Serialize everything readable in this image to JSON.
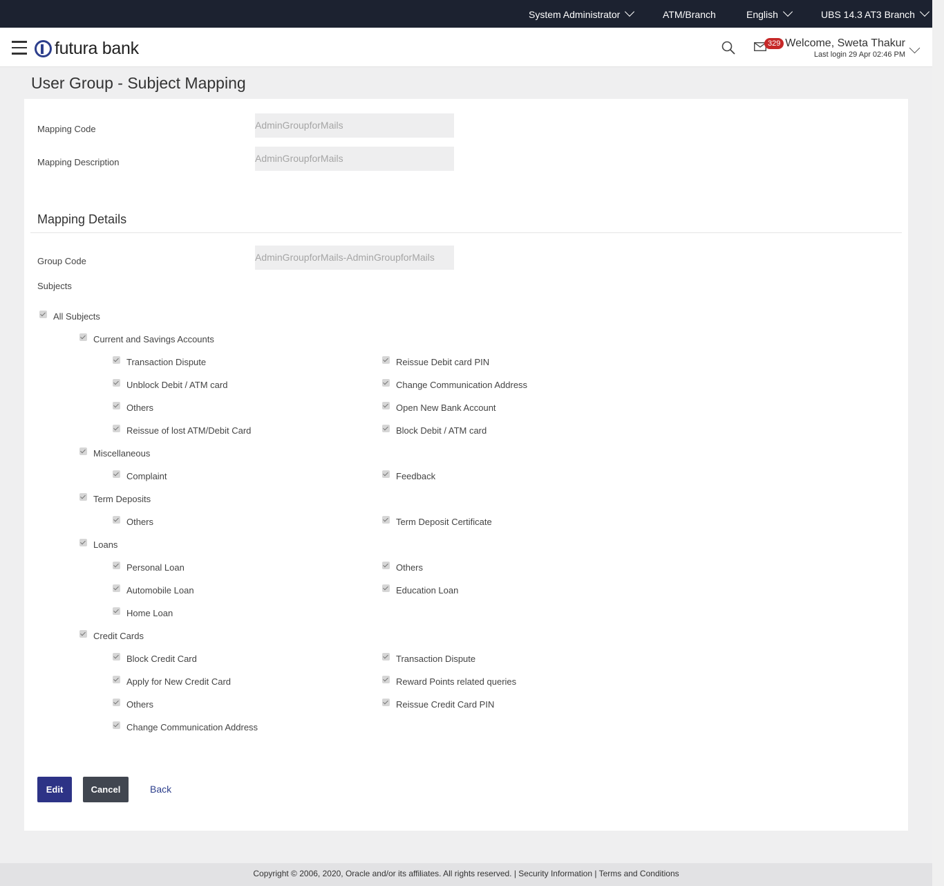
{
  "topbar": {
    "role": "System Administrator",
    "atm_branch": "ATM/Branch",
    "language": "English",
    "branch": "UBS 14.3 AT3 Branch"
  },
  "header": {
    "logo_text": "futura bank",
    "mail_count": "329",
    "welcome": "Welcome, Sweta Thakur",
    "last_login": "Last login 29 Apr 02:46 PM"
  },
  "page": {
    "title": "User Group - Subject Mapping"
  },
  "form": {
    "mapping_code_label": "Mapping Code",
    "mapping_code_value": "AdminGroupforMails",
    "mapping_description_label": "Mapping Description",
    "mapping_description_value": "AdminGroupforMails",
    "section_title": "Mapping Details",
    "group_code_label": "Group Code",
    "group_code_value": "AdminGroupforMails-AdminGroupforMails",
    "subjects_label": "Subjects"
  },
  "subjects": {
    "all": "All Subjects",
    "casa": {
      "label": "Current and Savings Accounts",
      "items": [
        "Transaction Dispute",
        "Reissue Debit card PIN",
        "Unblock Debit / ATM card",
        "Change Communication Address",
        "Others",
        "Open New Bank Account",
        "Reissue of lost ATM/Debit Card",
        "Block Debit / ATM card"
      ]
    },
    "misc": {
      "label": "Miscellaneous",
      "items": [
        "Complaint",
        "Feedback"
      ]
    },
    "td": {
      "label": "Term Deposits",
      "items": [
        "Others",
        "Term Deposit Certificate"
      ]
    },
    "loans": {
      "label": "Loans",
      "items": [
        "Personal Loan",
        "Others",
        "Automobile Loan",
        "Education Loan",
        "Home Loan"
      ]
    },
    "cc": {
      "label": "Credit Cards",
      "items": [
        "Block Credit Card",
        "Transaction Dispute",
        "Apply for New Credit Card",
        "Reward Points related queries",
        "Others",
        "Reissue Credit Card PIN",
        "Change Communication Address"
      ]
    }
  },
  "actions": {
    "edit": "Edit",
    "cancel": "Cancel",
    "back": "Back"
  },
  "footer": {
    "text": "Copyright © 2006, 2020, Oracle and/or its affiliates. All rights reserved. | Security Information | Terms and Conditions"
  },
  "colors": {
    "topbar_bg": "#1c2230",
    "primary_button": "#2d3386",
    "secondary_button": "#414650",
    "badge": "#c62828"
  }
}
